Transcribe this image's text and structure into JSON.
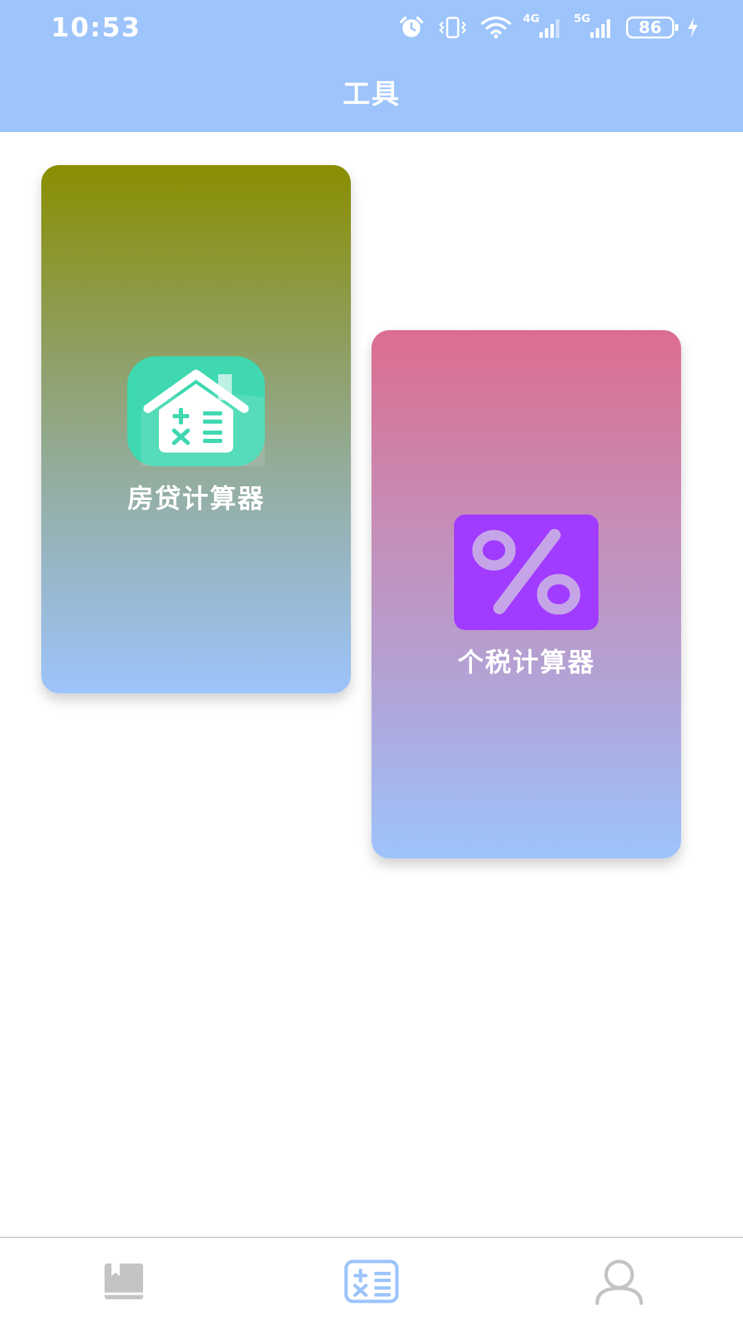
{
  "status_bar": {
    "time": "10:53",
    "battery": "86",
    "network_4g": "4G",
    "network_5g": "5G",
    "icons": [
      "alarm-icon",
      "vibrate-icon",
      "wifi-icon",
      "signal-4g-icon",
      "signal-5g-icon",
      "battery-icon",
      "charging-icon"
    ]
  },
  "header": {
    "title": "工具"
  },
  "tools": [
    {
      "label": "房贷计算器",
      "icon": "house-calculator-icon",
      "icon_color": "#3fd8b1"
    },
    {
      "label": "个税计算器",
      "icon": "percent-icon",
      "icon_color": "#a13bff"
    }
  ],
  "bottom_nav": {
    "items": [
      {
        "icon": "book-icon",
        "active": false
      },
      {
        "icon": "calculator-icon",
        "active": true
      },
      {
        "icon": "user-icon",
        "active": false
      }
    ],
    "active_color": "#9dc4fb",
    "inactive_color": "#c4c4c4"
  }
}
